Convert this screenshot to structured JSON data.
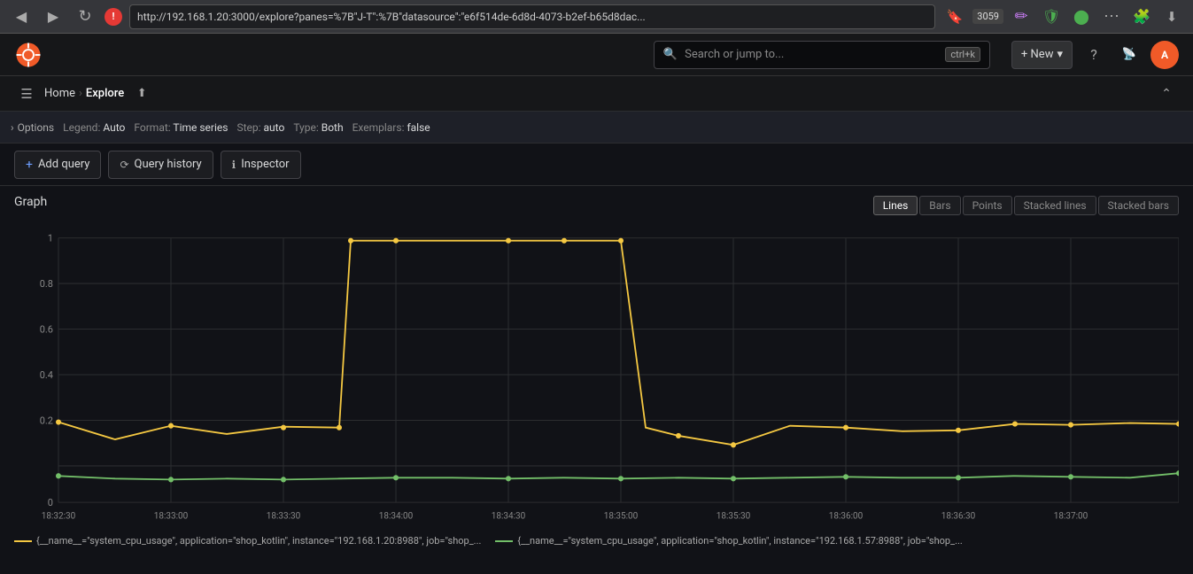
{
  "browser": {
    "back_icon": "◀",
    "forward_icon": "▶",
    "refresh_icon": "↻",
    "url": "http://192.168.1.20:3000/explore?panes=%7B\"J-T\":%7B\"datasource\":\"e6f514de-6d8d-4073-b2ef-b65d8dac...",
    "bookmark_icon": "🔖",
    "ext_badge": "3059",
    "more_icon": "⋯",
    "extensions_icon": "🧩",
    "download_icon": "⬇"
  },
  "header": {
    "search_placeholder": "Search or jump to...",
    "search_shortcut": "ctrl+k",
    "add_label": "+ New",
    "add_chevron": "▾",
    "help_icon": "?",
    "rss_icon": "RSS",
    "avatar_initials": "A"
  },
  "nav": {
    "menu_icon": "☰",
    "breadcrumbs": [
      "Home",
      "Explore"
    ],
    "share_icon": "⬆"
  },
  "options": {
    "toggle_label": "Options",
    "items": [
      {
        "key": "Legend:",
        "value": "Auto"
      },
      {
        "key": "Format:",
        "value": "Time series"
      },
      {
        "key": "Step:",
        "value": "auto"
      },
      {
        "key": "Type:",
        "value": "Both"
      },
      {
        "key": "Exemplars:",
        "value": "false"
      }
    ]
  },
  "toolbar": {
    "add_query_label": "Add query",
    "query_history_label": "Query history",
    "inspector_label": "Inspector"
  },
  "graph": {
    "title": "Graph",
    "view_buttons": [
      "Lines",
      "Bars",
      "Points",
      "Stacked lines",
      "Stacked bars"
    ],
    "active_view": "Lines",
    "y_labels": [
      "1",
      "0.8",
      "0.6",
      "0.4",
      "0.2",
      "0"
    ],
    "x_labels": [
      "18:32:30",
      "18:33:00",
      "18:33:30",
      "18:34:00",
      "18:34:30",
      "18:35:00",
      "18:35:30",
      "18:36:00",
      "18:36:30",
      "18:37:00"
    ],
    "series": {
      "yellow": {
        "color": "#f5c842",
        "legend": "{__name__=\"system_cpu_usage\", application=\"shop_kotlin\", instance=\"192.168.1.20:8988\", job=\"shop_..."
      },
      "green": {
        "color": "#73bf69",
        "legend": "{__name__=\"system_cpu_usage\", application=\"shop_kotlin\", instance=\"192.168.1.57:8988\", job=\"shop_..."
      }
    }
  }
}
